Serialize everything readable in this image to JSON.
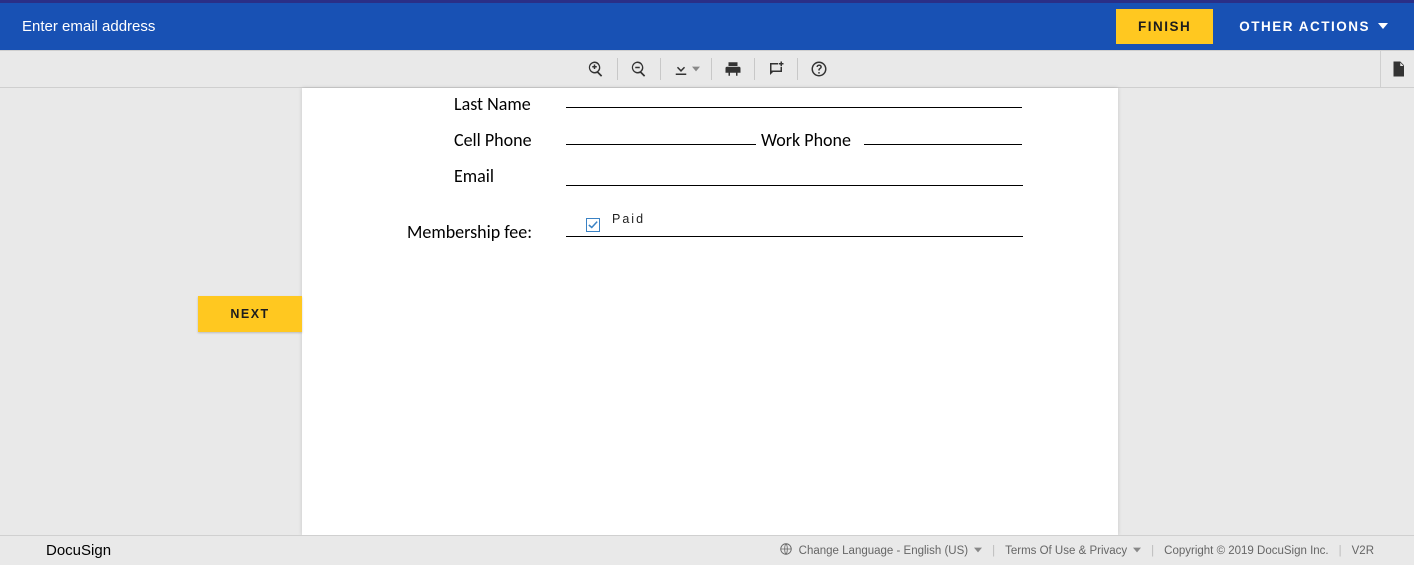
{
  "topbar": {
    "hint": "Enter email address",
    "finish_label": "FINISH",
    "other_actions_label": "OTHER ACTIONS"
  },
  "next_label": "NEXT",
  "form": {
    "last_name_label": "Last Name",
    "cell_phone_label": "Cell Phone",
    "work_phone_label": "Work Phone",
    "email_label": "Email",
    "membership_fee_label": "Membership fee:",
    "paid_label": "Paid",
    "paid_checked": true
  },
  "footer": {
    "brand": "DocuSign",
    "language_label": "Change Language - English (US)",
    "terms_label": "Terms Of Use & Privacy",
    "copyright": "Copyright © 2019 DocuSign Inc.",
    "version": "V2R"
  }
}
